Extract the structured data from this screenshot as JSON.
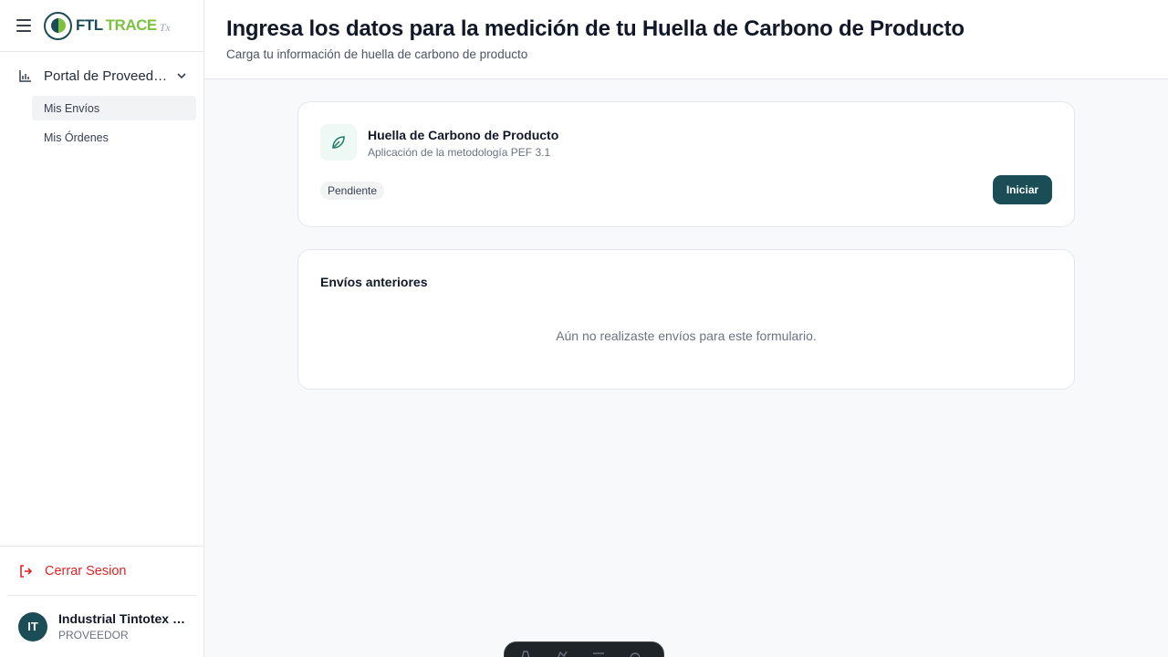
{
  "app": {
    "logo_ftl": "FTL",
    "logo_trace": "TRACE",
    "logo_tx": "Tx",
    "brand_color": "#1b4d57",
    "accent_color": "#7cc241",
    "danger_color": "#dc2626"
  },
  "sidebar": {
    "group_label": "Portal de Proveedor...",
    "group_icon": "bar-chart-icon",
    "items": [
      {
        "label": "Mis Envíos",
        "active": true
      },
      {
        "label": "Mis Órdenes",
        "active": false
      }
    ],
    "logout_label": "Cerrar Sesion",
    "user": {
      "initials": "IT",
      "name": "Industrial Tintotex S...",
      "role": "PROVEEDOR"
    }
  },
  "header": {
    "title": "Ingresa los datos para la medición de tu Huella de Carbono de Producto",
    "subtitle": "Carga tu información de huella de carbono de producto"
  },
  "form_card": {
    "icon": "leaf-icon",
    "title": "Huella de Carbono de Producto",
    "subtitle": "Aplicación de la metodología PEF 3.1",
    "status": "Pendiente",
    "action_label": "Iniciar"
  },
  "history_card": {
    "title": "Envíos anteriores",
    "empty_message": "Aún no realizaste envíos para este formulario."
  }
}
